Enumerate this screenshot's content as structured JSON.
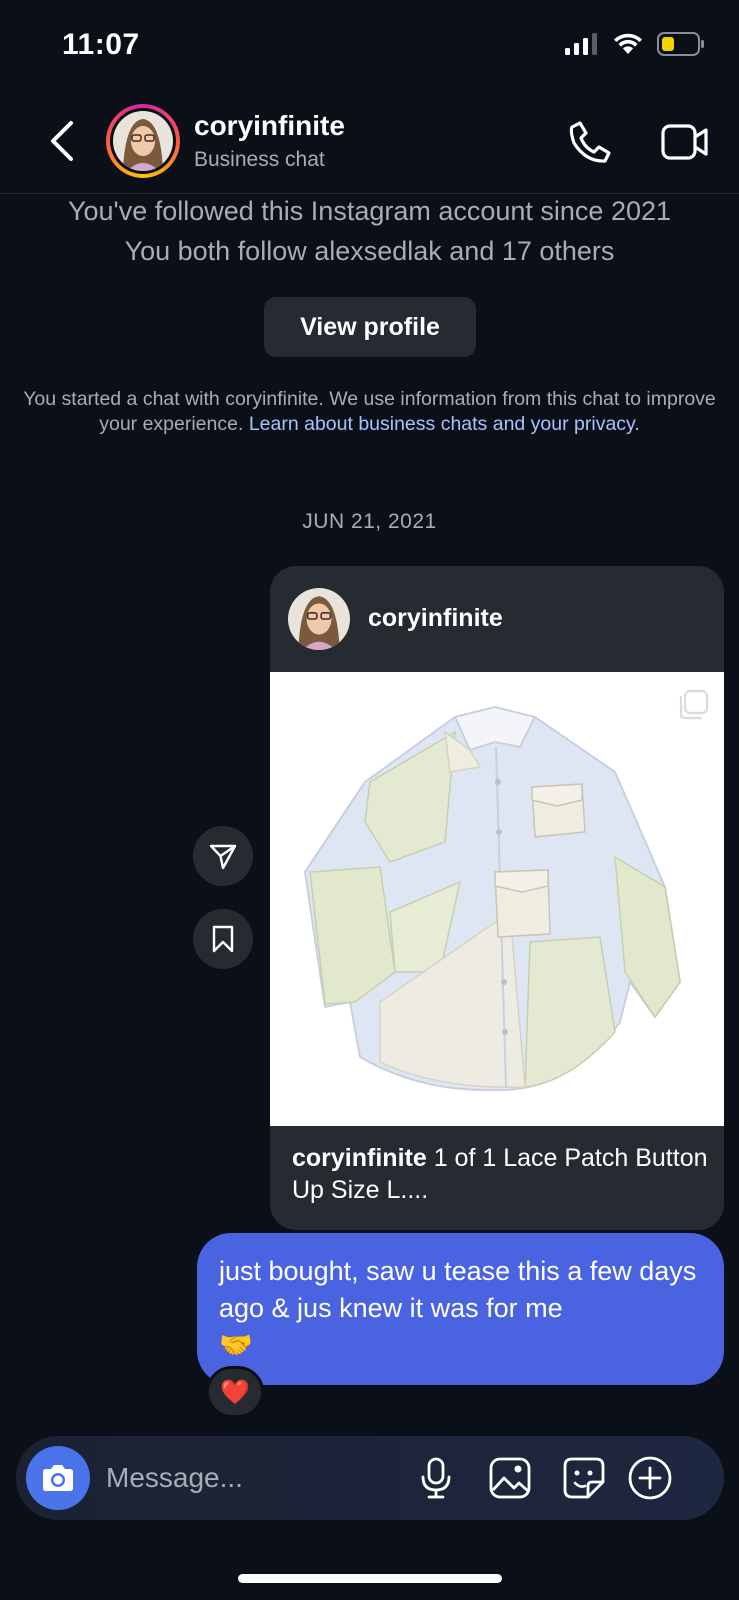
{
  "status_bar": {
    "time": "11:07",
    "icons": [
      "signal-icon",
      "wifi-icon",
      "battery-icon"
    ],
    "battery_color": "#f5d300"
  },
  "header": {
    "username": "coryinfinite",
    "subtitle": "Business chat",
    "icons": [
      "back-arrow-icon",
      "phone-icon",
      "video-camera-icon"
    ]
  },
  "profile_info": {
    "line1": "You've followed this Instagram account since 2021",
    "line2": "You both follow alexsedlak and 17 others",
    "view_profile_label": "View profile"
  },
  "disclaimer": {
    "text": "You started a chat with coryinfinite. We use information from this chat to improve your experience. ",
    "link_text": "Learn about business chats and your privacy",
    "link_tail": "."
  },
  "date_label": "JUN 21, 2021",
  "shared_post": {
    "username": "coryinfinite",
    "caption_user": "coryinfinite",
    "caption_text": " 1 of 1 Lace Patch Button Up Size L....",
    "image_subject": "white patchwork lace button-up shirt",
    "multi_image_icon": "carousel-icon"
  },
  "side_actions": {
    "share_icon": "paper-plane-icon",
    "save_icon": "bookmark-icon"
  },
  "message": {
    "text": "just bought, saw u tease this a few days ago & jus knew it was for me",
    "emoji": "🤝",
    "bubble_color": "#4a63e0",
    "reaction": "❤️"
  },
  "composer": {
    "placeholder": "Message...",
    "icons": [
      "camera-icon",
      "microphone-icon",
      "gallery-icon",
      "sticker-icon",
      "plus-icon"
    ],
    "camera_color": "#4b74ea"
  }
}
